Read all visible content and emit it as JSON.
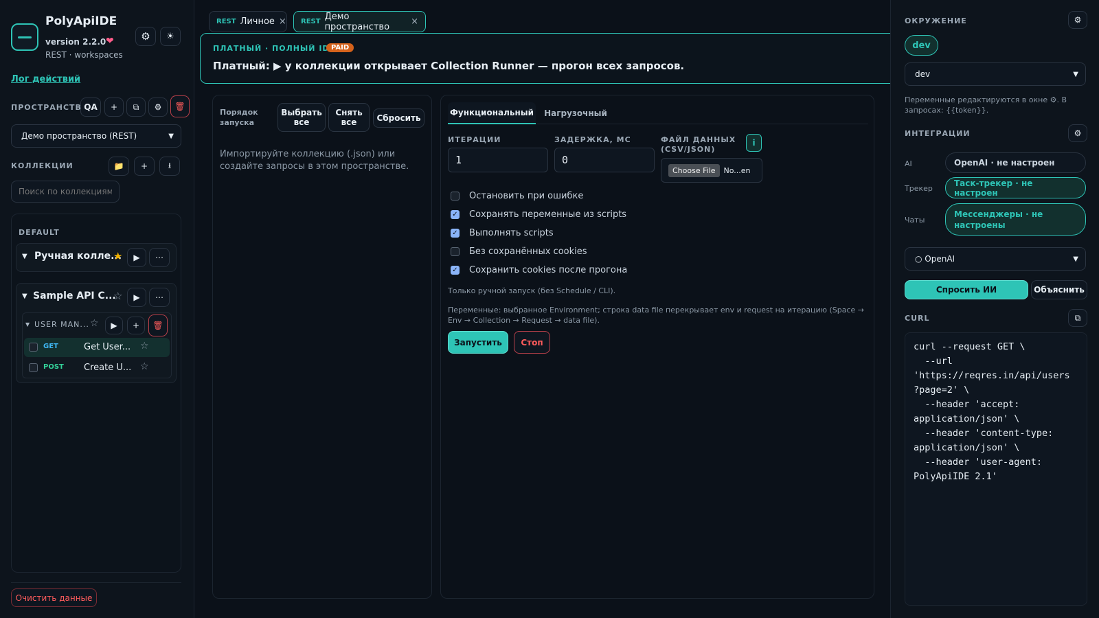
{
  "app": {
    "title": "PolyApiIDE",
    "version": "version 2.2.0",
    "subtitle": "REST · workspaces",
    "action_log_link": "Лог действий"
  },
  "workspace": {
    "label": "ПРОСТРАНСТВО",
    "tag": "QA",
    "selected": "Демо пространство (REST)"
  },
  "collections": {
    "label": "КОЛЛЕКЦИИ",
    "search_placeholder": "Поиск по коллекциям",
    "group_label": "DEFAULT",
    "items": [
      {
        "name": "Ручная колле...",
        "starred": true
      },
      {
        "name": "Sample API C...",
        "starred": false
      }
    ],
    "folder": {
      "name": "USER MAN...",
      "starred": false
    },
    "requests": [
      {
        "method": "GET",
        "name": "Get User...",
        "method_color": "#3fb8f5"
      },
      {
        "method": "POST",
        "name": "Create U...",
        "method_color": "#33d199"
      }
    ],
    "clear_button": "Очистить данные"
  },
  "tabs": [
    {
      "type": "REST",
      "label": "Личное"
    },
    {
      "type": "REST",
      "label": "Демо пространство"
    }
  ],
  "banner": {
    "tier": "ПЛАТНЫЙ · ПОЛНЫЙ IDE",
    "badge": "PAID",
    "message": "Платный: ▶ у коллекции открывает Collection Runner — прогон всех запросов."
  },
  "runner_left": {
    "order_label": "Порядок запуска",
    "select_all": "Выбрать все",
    "deselect_all": "Снять все",
    "reset": "Сбросить",
    "empty_text": "Импортируйте коллекцию (.json) или создайте запросы в этом пространстве."
  },
  "runner_right": {
    "tabs": [
      "Функциональный",
      "Нагрузочный"
    ],
    "iterations_label": "ИТЕРАЦИИ",
    "iterations_value": "1",
    "delay_label": "ЗАДЕРЖКА, МС",
    "delay_value": "0",
    "data_file_label": "ФАЙЛ ДАННЫХ (CSV/JSON)",
    "info_badge": "i",
    "choose_file": "Choose File",
    "file_name": "No...en",
    "options": [
      {
        "label": "Остановить при ошибке",
        "checked": false
      },
      {
        "label": "Сохранять переменные из scripts",
        "checked": true
      },
      {
        "label": "Выполнять scripts",
        "checked": true
      },
      {
        "label": "Без сохранённых cookies",
        "checked": false
      },
      {
        "label": "Сохранить cookies после прогона",
        "checked": true
      }
    ],
    "note_manual": "Только ручной запуск (без Schedule / CLI).",
    "note_vars": "Переменные: выбранное Environment; строка data file перекрывает env и request на итерацию (Space → Env → Collection → Request → data file).",
    "run_button": "Запустить",
    "stop_button": "Стоп"
  },
  "environment": {
    "label": "ОКРУЖЕНИЕ",
    "active_chip": "dev",
    "selected": "dev",
    "note": "Переменные редактируются в окне ⚙. В запросах: {{token}}."
  },
  "integrations": {
    "label": "ИНТЕГРАЦИИ",
    "rows": [
      {
        "name": "AI",
        "status": "OpenAI · не настроен"
      },
      {
        "name": "Трекер",
        "status": "Таск-трекер · не настроен"
      },
      {
        "name": "Чаты",
        "status": "Мессенджеры · не настроены"
      }
    ],
    "provider_selected": "○ OpenAI",
    "ask_ai": "Спросить ИИ",
    "explain": "Объяснить"
  },
  "curl": {
    "label": "CURL",
    "code": "curl --request GET \\\n  --url\n'https://reqres.in/api/users\n?page=2' \\\n  --header 'accept:\napplication/json' \\\n  --header 'content-type:\napplication/json' \\\n  --header 'user-agent:\nPolyApiIDE 2.1'"
  },
  "colors": {
    "accent": "#2ec4b6",
    "background": "#0b1119",
    "panel": "#0e1620",
    "danger": "#ff5c5c",
    "paid_badge": "#d4621b"
  }
}
